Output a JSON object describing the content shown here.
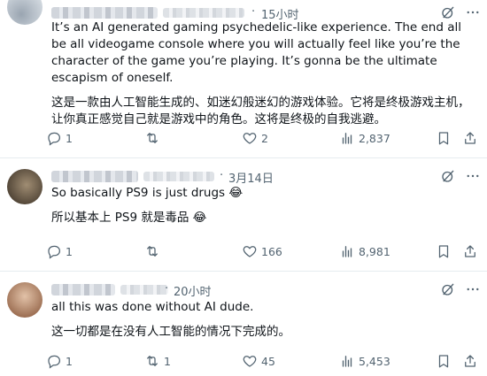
{
  "replies": [
    {
      "time": "15小时",
      "text_en": "It’s an AI generated gaming psychedelic-like experience. The end all be all videogame console where you will actually feel like you’re the character of the game you’re playing. It’s gonna be  the ultimate escapism of oneself.",
      "text_zh": "这是一款由人工智能生成的、如迷幻般迷幻的游戏体验。它将是终极游戏主机，让你真正感觉自己就是游戏中的角色。这将是终极的自我逃避。",
      "replies": "1",
      "reposts": "",
      "likes": "2",
      "views": "2,837",
      "avatar_color": "#b8c2cc"
    },
    {
      "time": "3月14日",
      "text_en": "So basically PS9 is just drugs 😂",
      "text_zh": "所以基本上 PS9 就是毒品 😂",
      "replies": "1",
      "reposts": "",
      "likes": "166",
      "views": "8,981",
      "avatar_color": "#7a6a55"
    },
    {
      "time": "20小时",
      "text_en": "all this was done without AI dude.",
      "text_zh": "这一切都是在没有人工智能的情况下完成的。",
      "replies": "1",
      "reposts": "1",
      "likes": "45",
      "views": "5,453",
      "avatar_color": "#c8a084"
    }
  ],
  "colors": {
    "text": "#0f1419",
    "muted": "#536471",
    "divider": "#e6ecf0"
  },
  "icons": [
    "reply-icon",
    "repost-icon",
    "like-icon",
    "views-icon",
    "bookmark-icon",
    "share-icon",
    "grok-icon",
    "more-icon"
  ]
}
